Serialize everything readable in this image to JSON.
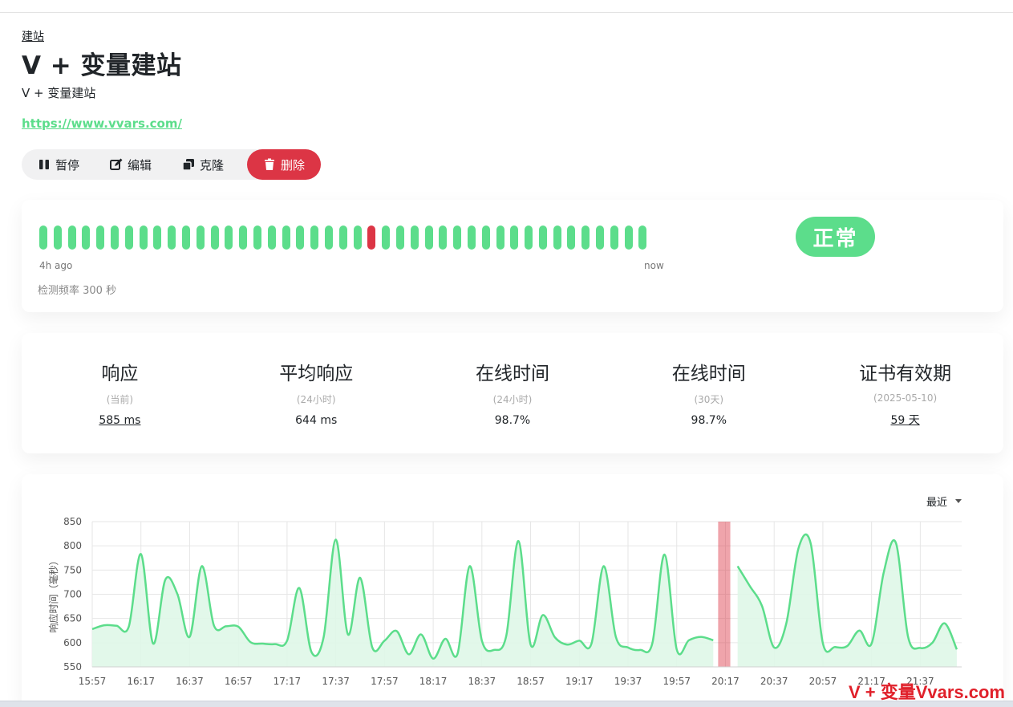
{
  "breadcrumb": "建站",
  "title": "V + 变量建站",
  "subtitle": "V + 变量建站",
  "url": "https://www.vvars.com/",
  "actions": {
    "pause": "暂停",
    "edit": "编辑",
    "clone": "克隆",
    "delete": "删除"
  },
  "heartbeat": {
    "beats": [
      "up",
      "up",
      "up",
      "up",
      "up",
      "up",
      "up",
      "up",
      "up",
      "up",
      "up",
      "up",
      "up",
      "up",
      "up",
      "up",
      "up",
      "up",
      "up",
      "up",
      "up",
      "up",
      "up",
      "down",
      "up",
      "up",
      "up",
      "up",
      "up",
      "up",
      "up",
      "up",
      "up",
      "up",
      "up",
      "up",
      "up",
      "up",
      "up",
      "up",
      "up",
      "up",
      "up"
    ],
    "start_label": "4h ago",
    "end_label": "now",
    "frequency": "检测频率 300 秒",
    "status": "正常"
  },
  "stats": [
    {
      "title": "响应",
      "sub": "(当前)",
      "value": "585 ms",
      "link": true
    },
    {
      "title": "平均响应",
      "sub": "(24小时)",
      "value": "644 ms",
      "link": false
    },
    {
      "title": "在线时间",
      "sub": "(24小时)",
      "value": "98.7%",
      "link": false
    },
    {
      "title": "在线时间",
      "sub": "(30天)",
      "value": "98.7%",
      "link": false
    },
    {
      "title": "证书有效期",
      "sub": "(2025-05-10)",
      "value": "59 天",
      "link": true
    }
  ],
  "range_select": "最近",
  "colors": {
    "up": "#5cdd8b",
    "down": "#dc3545",
    "fill": "#dff7e8"
  },
  "watermark": "V + 变量Vvars.com",
  "chart_data": {
    "type": "line",
    "ylabel": "响应时间（毫秒）",
    "ylim": [
      550,
      850
    ],
    "yticks": [
      550,
      600,
      650,
      700,
      750,
      800,
      850
    ],
    "xticks": [
      "15:57",
      "16:17",
      "16:37",
      "16:57",
      "17:17",
      "17:37",
      "17:57",
      "18:17",
      "18:37",
      "18:57",
      "19:17",
      "19:37",
      "19:57",
      "20:17",
      "20:37",
      "20:57",
      "21:17",
      "21:37"
    ],
    "x_start_minutes": 957,
    "x_end_minutes": 1314,
    "down_period": [
      "20:14",
      "20:19"
    ],
    "series": [
      {
        "x": [
          "15:57",
          "16:02",
          "16:07",
          "16:12",
          "16:17",
          "16:22",
          "16:27",
          "16:32",
          "16:37",
          "16:42",
          "16:47",
          "16:52",
          "16:57",
          "17:02",
          "17:07",
          "17:12",
          "17:17",
          "17:22",
          "17:27",
          "17:32",
          "17:37",
          "17:42",
          "17:47",
          "17:52",
          "17:57",
          "18:02",
          "18:07",
          "18:12",
          "18:17",
          "18:22",
          "18:27",
          "18:32",
          "18:37",
          "18:42",
          "18:47",
          "18:52",
          "18:57",
          "19:02",
          "19:07",
          "19:12",
          "19:17",
          "19:22",
          "19:27",
          "19:32",
          "19:37",
          "19:42",
          "19:47",
          "19:52",
          "19:57",
          "20:02",
          "20:07",
          "20:12"
        ],
        "values": [
          628,
          636,
          635,
          633,
          783,
          598,
          730,
          700,
          612,
          758,
          635,
          634,
          633,
          601,
          598,
          597,
          604,
          713,
          581,
          611,
          813,
          617,
          734,
          590,
          604,
          624,
          576,
          617,
          567,
          608,
          577,
          758,
          604,
          585,
          614,
          810,
          596,
          657,
          611,
          596,
          604,
          598,
          758,
          612,
          590,
          585,
          599,
          782,
          586,
          605,
          612,
          605
        ]
      },
      {
        "x": [
          "20:22",
          "20:27",
          "20:32",
          "20:37",
          "20:42",
          "20:47",
          "20:52",
          "20:57",
          "21:02",
          "21:07",
          "21:12",
          "21:17",
          "21:22",
          "21:27",
          "21:32",
          "21:37",
          "21:42",
          "21:47",
          "21:52"
        ],
        "values": [
          758,
          717,
          676,
          590,
          640,
          795,
          805,
          599,
          591,
          593,
          625,
          598,
          745,
          806,
          612,
          589,
          600,
          640,
          586
        ]
      }
    ]
  }
}
